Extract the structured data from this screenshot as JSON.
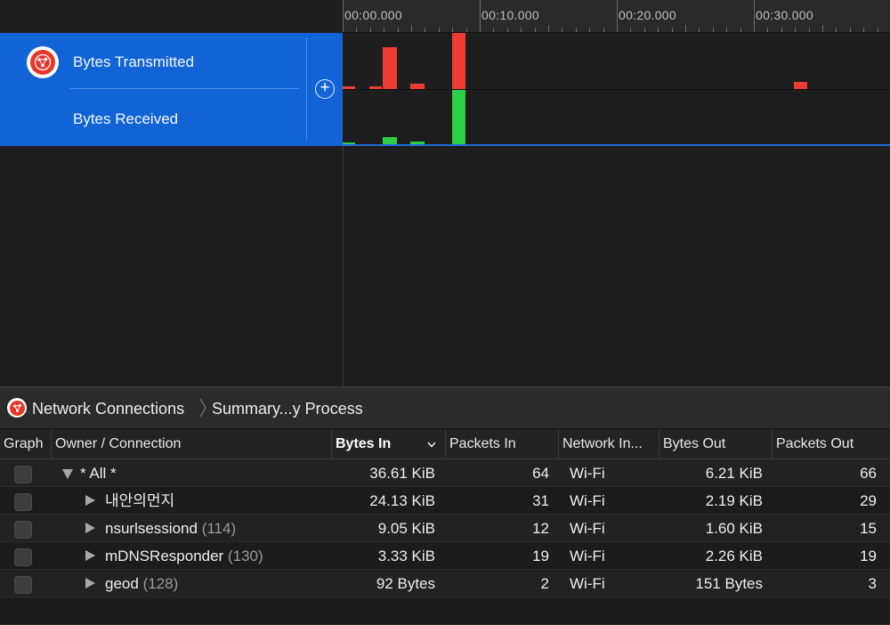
{
  "timeline": {
    "ticks": [
      "00:00.000",
      "00:10.000",
      "00:20.000",
      "00:30.000"
    ]
  },
  "track": {
    "icon": "network-activity-icon",
    "transmitted_label": "Bytes Transmitted",
    "received_label": "Bytes Received",
    "add_button_label": "+",
    "accent_color": "#1264d6"
  },
  "graph_colors": {
    "transmitted": "#f03b34",
    "received": "#2ccf45"
  },
  "breadcrumb": {
    "items": [
      "Network Connections",
      "Summary...y Process"
    ]
  },
  "table": {
    "columns": [
      "Graph",
      "Owner / Connection",
      "Bytes In",
      "Packets In",
      "Network In...",
      "Bytes Out",
      "Packets Out"
    ],
    "sorted_column": "Bytes In",
    "rows": [
      {
        "owner": "* All *",
        "pid": "",
        "bytes_in": "36.61 KiB",
        "packets_in": "64",
        "network": "Wi-Fi",
        "bytes_out": "6.21 KiB",
        "packets_out": "66",
        "expanded": true,
        "level": 0
      },
      {
        "owner": "내안의먼지",
        "pid": "",
        "bytes_in": "24.13 KiB",
        "packets_in": "31",
        "network": "Wi-Fi",
        "bytes_out": "2.19 KiB",
        "packets_out": "29",
        "expanded": false,
        "level": 1
      },
      {
        "owner": "nsurlsessiond",
        "pid": "(114)",
        "bytes_in": "9.05 KiB",
        "packets_in": "12",
        "network": "Wi-Fi",
        "bytes_out": "1.60 KiB",
        "packets_out": "15",
        "expanded": false,
        "level": 1
      },
      {
        "owner": "mDNSResponder",
        "pid": "(130)",
        "bytes_in": "3.33 KiB",
        "packets_in": "19",
        "network": "Wi-Fi",
        "bytes_out": "2.26 KiB",
        "packets_out": "19",
        "expanded": false,
        "level": 1
      },
      {
        "owner": "geod",
        "pid": "(128)",
        "bytes_in": "92 Bytes",
        "packets_in": "2",
        "network": "Wi-Fi",
        "bytes_out": "151 Bytes",
        "packets_out": "3",
        "expanded": false,
        "level": 1
      }
    ]
  }
}
